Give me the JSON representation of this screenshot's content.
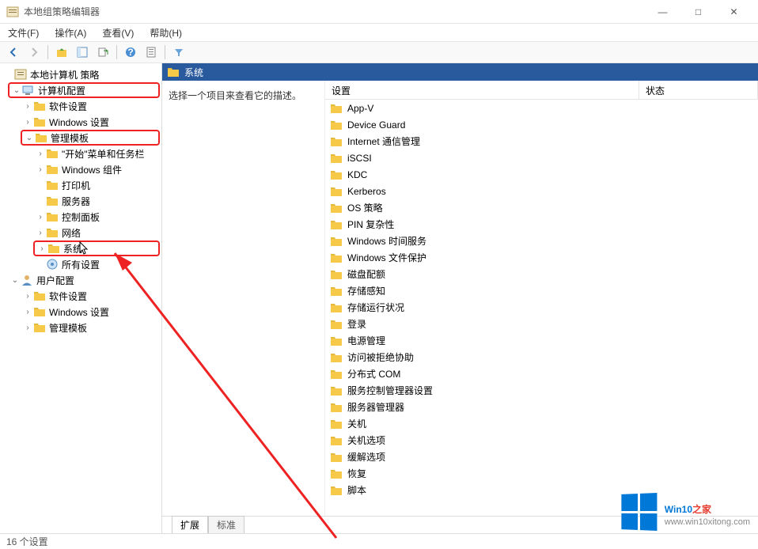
{
  "window": {
    "title": "本地组策略编辑器",
    "minimize": "—",
    "maximize": "□",
    "close": "✕"
  },
  "menubar": {
    "file": "文件(F)",
    "action": "操作(A)",
    "view": "查看(V)",
    "help": "帮助(H)"
  },
  "toolbar": {
    "icons": [
      "back-arrow",
      "forward-arrow",
      "folder-up",
      "tree-view",
      "export",
      "refresh",
      "help",
      "properties",
      "filter"
    ]
  },
  "tree": {
    "root": "本地计算机 策略",
    "computer_config": "计算机配置",
    "software_settings1": "软件设置",
    "windows_settings1": "Windows 设置",
    "admin_templates": "管理模板",
    "start_taskbar": "\"开始\"菜单和任务栏",
    "windows_components": "Windows 组件",
    "printers": "打印机",
    "servers": "服务器",
    "control_panel": "控制面板",
    "network": "网络",
    "system": "系统",
    "all_settings": "所有设置",
    "user_config": "用户配置",
    "software_settings2": "软件设置",
    "windows_settings2": "Windows 设置",
    "admin_templates2": "管理模板"
  },
  "content": {
    "header": "系统",
    "description": "选择一个项目来查看它的描述。",
    "col_settings": "设置",
    "col_status": "状态",
    "items": [
      "App-V",
      "Device Guard",
      "Internet 通信管理",
      "iSCSI",
      "KDC",
      "Kerberos",
      "OS 策略",
      "PIN 复杂性",
      "Windows 时间服务",
      "Windows 文件保护",
      "磁盘配额",
      "存储感知",
      "存储运行状况",
      "登录",
      "电源管理",
      "访问被拒绝协助",
      "分布式 COM",
      "服务控制管理器设置",
      "服务器管理器",
      "关机",
      "关机选项",
      "缓解选项",
      "恢复",
      "脚本"
    ],
    "tab_extended": "扩展",
    "tab_standard": "标准"
  },
  "statusbar": {
    "text": "16 个设置"
  },
  "watermark": {
    "brand_main": "Win10",
    "brand_accent": "之家",
    "url": "www.win10xitong.com"
  }
}
